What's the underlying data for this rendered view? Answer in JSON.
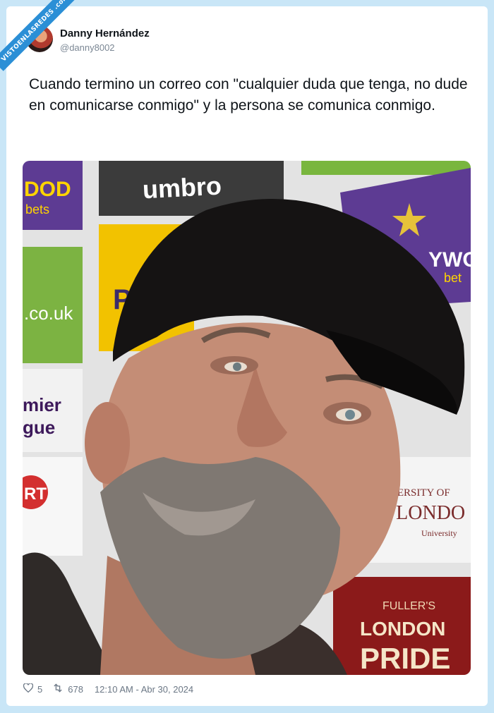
{
  "watermark": "VISTOENLASREDES .com",
  "author": {
    "name": "Danny Hernández",
    "handle": "@danny8002"
  },
  "tweet": {
    "text": "Cuando termino un correo con \"cualquier duda que tenga, no dude en comunicarse conmigo\" y la persona se comunica conmigo."
  },
  "photo": {
    "boards": {
      "umbro": "umbro",
      "dod": "DOD",
      "bets1": "bets",
      "couk": ".co.uk",
      "p": "P",
      "mier": "mier",
      "gue": "gue",
      "rt": "RT",
      "ywood": "YWOOD",
      "bet2": "bet",
      "univ1": "VERSITY OF",
      "univ2": "ST LONDO",
      "univ3": "University",
      "fullers": "FULLER'S",
      "london": "LONDON",
      "pride": "PRIDE"
    }
  },
  "stats": {
    "likes": "5",
    "retweets": "678",
    "timestamp": "12:10 AM - Abr 30, 2024"
  },
  "colors": {
    "background": "#c9e6f7",
    "card": "#ffffff",
    "ribbon": "#2b8fd6"
  },
  "icons": {
    "like": "heart-icon",
    "retweet": "retweet-icon"
  }
}
